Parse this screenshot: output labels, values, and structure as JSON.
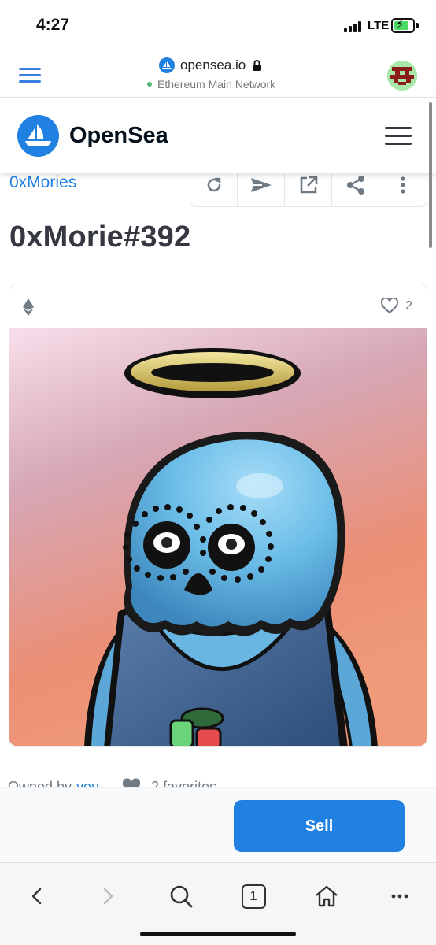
{
  "status_bar": {
    "time": "4:27",
    "network_type": "LTE",
    "icons": [
      "signal-icon",
      "battery-charging-icon"
    ]
  },
  "browser": {
    "domain": "opensea.io",
    "network": "Ethereum Main Network",
    "icons": [
      "menu-icon",
      "opensea-favicon",
      "lock-icon",
      "account-avatar"
    ]
  },
  "header": {
    "brand": "OpenSea",
    "brand_color": "#2081e2",
    "icons": [
      "opensea-logo-icon",
      "hamburger-menu-icon"
    ]
  },
  "item": {
    "collection": "0xMories",
    "title": "0xMorie#392",
    "favorites_count": "2",
    "toolbar_icons": [
      "refresh-icon",
      "send-icon",
      "external-link-icon",
      "share-icon",
      "more-options-icon"
    ],
    "chain_icon": "ethereum-icon"
  },
  "owner": {
    "owned_by_label": "Owned by",
    "owner_name": "you",
    "favorites_text": "2 favorites"
  },
  "actions": {
    "sell_label": "Sell"
  },
  "safari_toolbar": {
    "tab_count": "1",
    "icons": [
      "back-icon",
      "forward-icon",
      "search-icon",
      "tabs-icon",
      "home-icon",
      "more-icon"
    ]
  },
  "colors": {
    "accent": "#2081e2",
    "title_text": "#353840",
    "muted_text": "#707a83",
    "nft_bg_top": "#f4dbe6",
    "nft_bg_bottom": "#ee8a66"
  }
}
